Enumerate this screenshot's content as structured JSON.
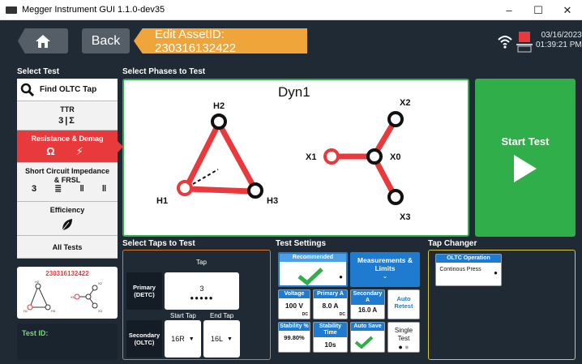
{
  "window": {
    "title": "Megger Instrument GUI 1.1.0-dev35",
    "controls": [
      "–",
      "☐",
      "✕"
    ]
  },
  "header": {
    "back_label": "Back",
    "asset_edit": "Edit AssetID: 230316132422",
    "date": "03/16/2023",
    "time": "01:39:21 PM"
  },
  "sections": {
    "select_test": "Select Test",
    "select_phases": "Select Phases to Test",
    "select_taps": "Select Taps to Test",
    "test_settings": "Test Settings",
    "tap_changer": "Tap Changer"
  },
  "tests": {
    "find_oltc": "Find OLTC Tap",
    "ttr": "TTR",
    "resistance": "Resistance & Demag",
    "sci_line1": "Short Circuit Impedance",
    "sci_line2": "& FRSL",
    "efficiency": "Efficiency",
    "all_tests": "All Tests"
  },
  "asset_card": {
    "asset_id": "230316132422"
  },
  "test_id_label": "Test ID:",
  "phases": {
    "vector_group": "Dyn1",
    "h1": "H1",
    "h2": "H2",
    "h3": "H3",
    "x0": "X0",
    "x1": "X1",
    "x2": "X2",
    "x3": "X3"
  },
  "start_test_label": "Start Test",
  "taps": {
    "tap_header": "Tap",
    "primary_label": "Primary (DETC)",
    "primary_value": "3",
    "start_tap_label": "Start Tap",
    "end_tap_label": "End Tap",
    "secondary_label": "Secondary (OLTC)",
    "start_tap_value": "16R",
    "end_tap_value": "16L"
  },
  "settings": {
    "recommended": "Recommended",
    "measurements": "Measurements & Limits",
    "voltage_label": "Voltage",
    "voltage_value": "100 V",
    "primary_a_label": "Primary A",
    "primary_a_value": "8.0 A",
    "secondary_a_label": "Secondary A",
    "secondary_a_value": "16.0 A",
    "auto_retest": "Auto Retest",
    "stability_label": "Stability %",
    "stability_value": "99.80%",
    "stability_time_label": "Stability Time",
    "stability_time_value": "10s",
    "auto_save": "Auto Save",
    "test_mode": "Single Test",
    "dc": "DC"
  },
  "tap_changer": {
    "oltc_operation": "OLTC Operation",
    "operation_value": "Continous Press"
  },
  "colors": {
    "accent_red": "#e83a3c",
    "accent_green": "#2fae4a",
    "accent_orange": "#f0a53a",
    "accent_blue": "#1e7bd0"
  },
  "icons": [
    "home-icon",
    "wifi-icon",
    "battery-icon",
    "search-icon",
    "play-icon",
    "checkmark-icon",
    "leaf-icon"
  ]
}
